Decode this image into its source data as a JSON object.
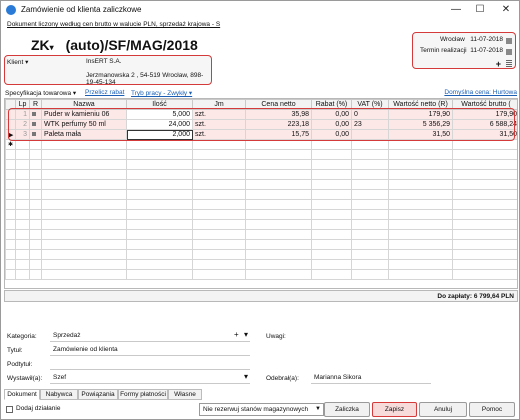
{
  "window": {
    "title": "Zamówienie od klienta zaliczkowe",
    "subtitle": "Dokument liczony według cen brutto w walucie PLN, sprzedaż krajowa - S",
    "min": "—",
    "max": "☐",
    "close": "✕"
  },
  "doc": {
    "type": "ZK",
    "type_caret": "▾",
    "number": "(auto)/SF/MAG/2018"
  },
  "dates": {
    "city": "Wrocław",
    "city_date": "11-07-2018",
    "due_label": "Termin realizacji",
    "due_date": "11-07-2018",
    "plus": "+"
  },
  "client": {
    "label": "Klient ▾",
    "name": "InsERT S.A.",
    "address": "Jerzmanowska 2 , 54-519 Wrocław, 898-19-45-134"
  },
  "toolbar": {
    "spec": "Specyfikacja towarowa ▾",
    "recalc": "Przelicz rabat",
    "workmode": "Tryb pracy - Zwykły ▾",
    "default_price": "Domyślna cena: Hurtowa"
  },
  "grid": {
    "headers": [
      "Lp",
      "R",
      "Nazwa",
      "Ilość",
      "Jm",
      "Cena netto",
      "Rabat (%)",
      "VAT (%)",
      "Wartość netto (R)",
      "Wartość brutto ("
    ],
    "rows": [
      {
        "lp": "1",
        "name": "Puder w kamieniu 06",
        "qty": "5,000",
        "unit": "szt.",
        "price": "35,98",
        "disc": "0,00",
        "vat": "0",
        "net": "179,90",
        "gross": "179,90"
      },
      {
        "lp": "2",
        "name": "WTK perfumy 50 ml",
        "qty": "24,000",
        "unit": "szt.",
        "price": "223,18",
        "disc": "0,00",
        "vat": "23",
        "net": "5 356,29",
        "gross": "6 588,24"
      },
      {
        "lp": "3",
        "name": "Paleta mała",
        "qty": "2,000",
        "unit": "szt.",
        "price": "15,75",
        "disc": "0,00",
        "vat": "",
        "net": "31,50",
        "gross": "31,50"
      }
    ],
    "new_row_marker": "✱",
    "current_row_marker": "▶"
  },
  "total": "Do zapłaty: 6 799,64 PLN",
  "form": {
    "kategoria_label": "Kategoria:",
    "kategoria": "Sprzedaż",
    "tytul_label": "Tytuł:",
    "tytul": "Zamówienie od klienta",
    "podtytul_label": "Podtytuł:",
    "podtytul": "",
    "wystawil_label": "Wystawił(a):",
    "wystawil": "Szef",
    "uwagi_label": "Uwagi:",
    "odebral_label": "Odebrał(a):",
    "odebral": "Marianna Sikora"
  },
  "tabs": [
    "Dokument",
    "Nabywca",
    "Powiązania",
    "Formy płatności",
    "Własne"
  ],
  "bottom": {
    "dodaj": "Dodaj działanie",
    "rezerwacja": "Nie rezerwuj stanów magazynowych",
    "zaliczka": "Zaliczka",
    "zapisz": "Zapisz",
    "anuluj": "Anuluj",
    "pomoc": "Pomoc"
  }
}
